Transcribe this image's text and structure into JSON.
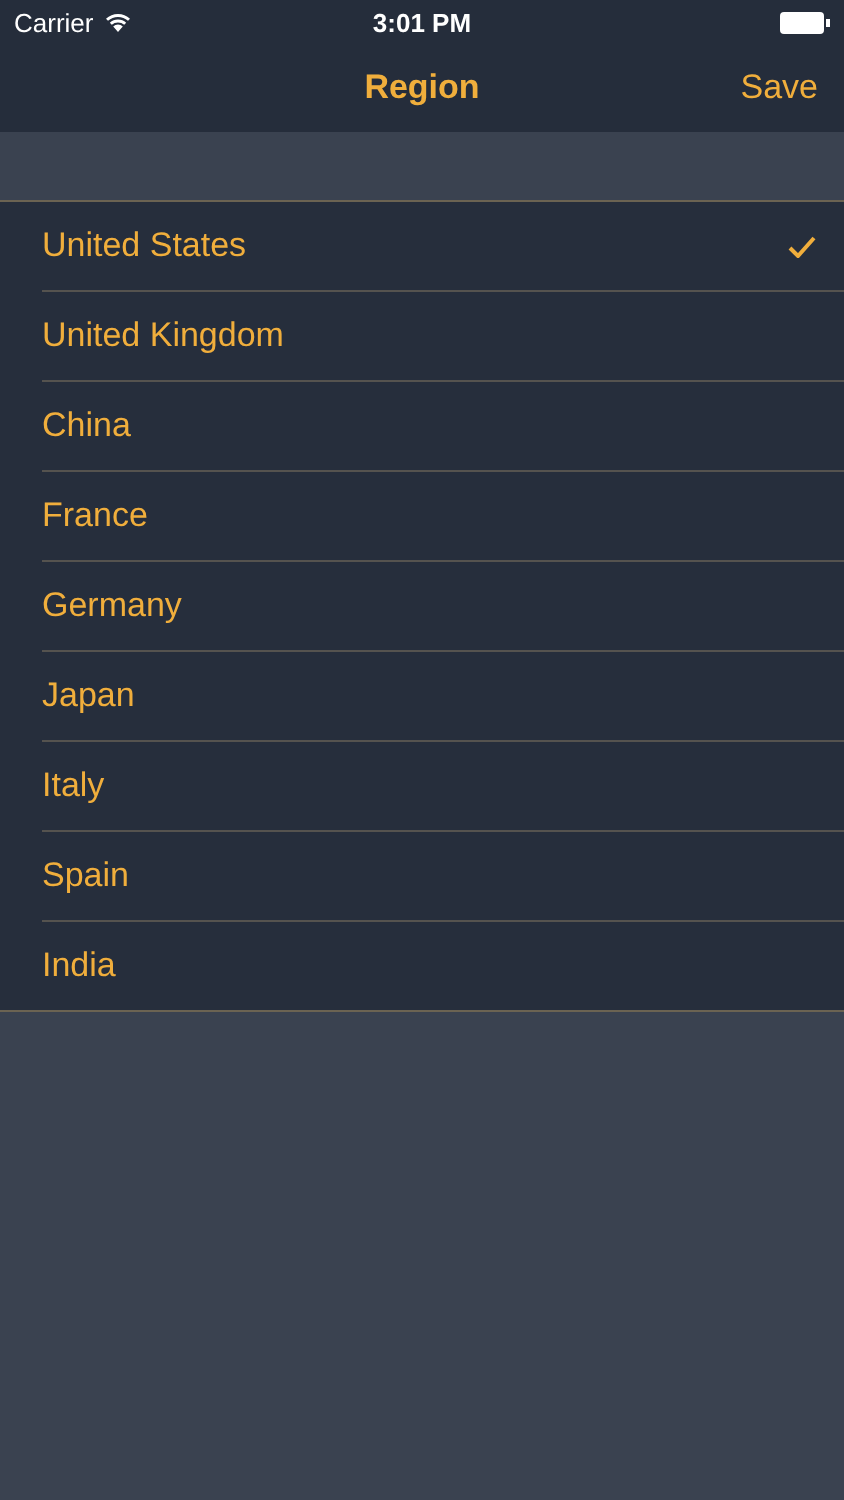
{
  "status_bar": {
    "carrier": "Carrier",
    "time": "3:01 PM"
  },
  "nav_bar": {
    "title": "Region",
    "action": "Save"
  },
  "regions": [
    {
      "label": "United States",
      "selected": true
    },
    {
      "label": "United Kingdom",
      "selected": false
    },
    {
      "label": "China",
      "selected": false
    },
    {
      "label": "France",
      "selected": false
    },
    {
      "label": "Germany",
      "selected": false
    },
    {
      "label": "Japan",
      "selected": false
    },
    {
      "label": "Italy",
      "selected": false
    },
    {
      "label": "Spain",
      "selected": false
    },
    {
      "label": "India",
      "selected": false
    }
  ]
}
